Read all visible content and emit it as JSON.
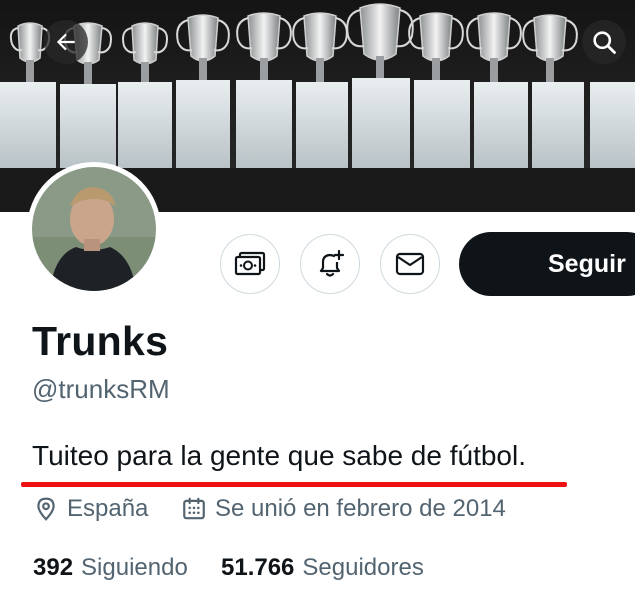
{
  "banner": {
    "description_icon": "trophies-image"
  },
  "header": {
    "back_icon": "back-arrow-icon",
    "search_icon": "search-icon"
  },
  "profile": {
    "name": "Trunks",
    "handle": "@trunksRM",
    "bio": "Tuiteo para la gente que sabe de fútbol.",
    "location": "España",
    "joined": "Se unió en febrero de 2014",
    "following_count": "392",
    "following_label": "Siguiendo",
    "followers_count": "51.766",
    "followers_label": "Seguidores"
  },
  "actions": {
    "tip_icon": "money-icon",
    "notify_icon": "bell-plus-icon",
    "message_icon": "envelope-icon",
    "follow_label": "Seguir"
  },
  "colors": {
    "accent_underline": "#ee1111",
    "follow_bg": "#0f1419",
    "muted_text": "#536471"
  }
}
